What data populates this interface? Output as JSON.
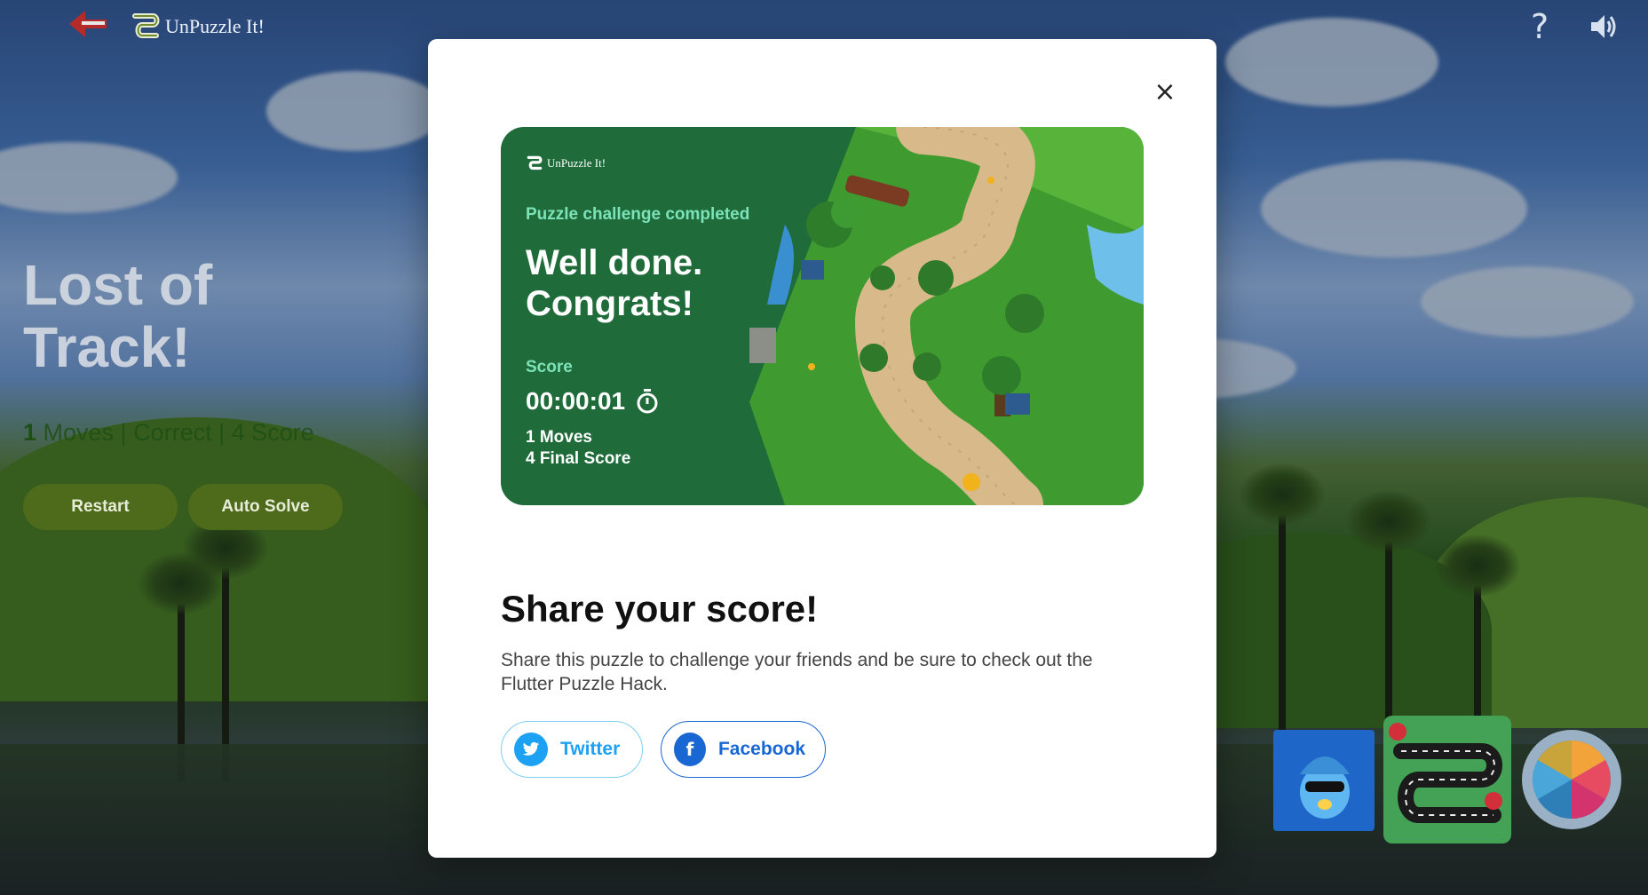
{
  "app": {
    "title": "UnPuzzle It!",
    "icons": {
      "back": "arrow-left-icon",
      "help": "help-icon",
      "sound": "volume-icon"
    },
    "help_glyph": "?"
  },
  "left_panel": {
    "title": "Lost of Track!",
    "moves_count": "1",
    "stats_rest": " Moves | Correct | 4 Score",
    "restart_label": "Restart",
    "auto_solve_label": "Auto Solve"
  },
  "modal": {
    "close_glyph": "×",
    "card": {
      "logo_text": "UnPuzzle It!",
      "kicker": "Puzzle challenge completed",
      "headline": "Well done. Congrats!",
      "score_label": "Score",
      "time": "00:00:01",
      "moves_line": "1 Moves",
      "final_score_line": "4 Final Score",
      "timer_icon": "timer-icon"
    },
    "share": {
      "title": "Share your score!",
      "description": "Share this puzzle to challenge your friends and be sure to check out the Flutter Puzzle Hack.",
      "twitter_label": "Twitter",
      "facebook_label": "Facebook",
      "facebook_glyph": "f"
    }
  },
  "colors": {
    "card_green": "#1f6b3a",
    "accent_mint": "#7ce3b8",
    "twitter_blue": "#1da1f2",
    "facebook_blue": "#1967d2",
    "pill_green": "#4d6b1a"
  }
}
